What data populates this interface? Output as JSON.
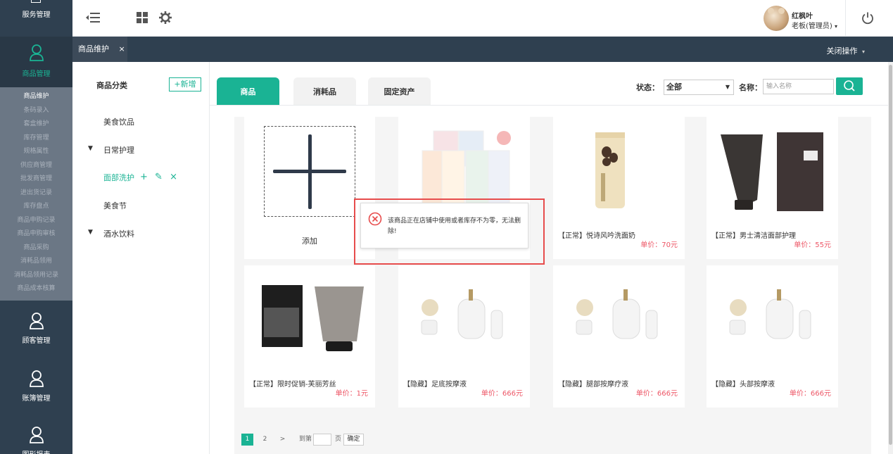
{
  "nav": {
    "top_label": "服务管理",
    "sections": [
      {
        "label": "商品管理",
        "icon": "user-icon"
      },
      {
        "label": "顾客管理",
        "icon": "user-icon"
      },
      {
        "label": "账簿管理",
        "icon": "user-icon"
      },
      {
        "label": "图形报表",
        "icon": "user-icon"
      }
    ],
    "sub_items": [
      "商品维护",
      "条码录入",
      "套盒维护",
      "库存管理",
      "规格属性",
      "供应商管理",
      "批发商管理",
      "进出货记录",
      "库存盘点",
      "商品申购记录",
      "商品申购审核",
      "商品采购",
      "消耗品领用",
      "消耗品领用记录",
      "商品成本核算"
    ]
  },
  "topbar": {
    "icons": [
      "menu-collapse-icon",
      "grid-icon",
      "gear-icon"
    ],
    "user_name": "红枫叶",
    "user_role": "老板(管理员)",
    "caret": "▾"
  },
  "tabstrip": {
    "tab_label": "商品维护",
    "tab_close": "×",
    "close_ops": "关闭操作",
    "caret": "▾"
  },
  "category": {
    "title": "商品分类",
    "add_label": "+新增",
    "arrow": "▼",
    "items": [
      "美食饮品",
      "日常护理",
      "面部洗护",
      "美食节",
      "酒水饮料"
    ]
  },
  "main": {
    "tabs": [
      "商品",
      "消耗品",
      "固定资产"
    ],
    "status_label": "状态：",
    "status_value": "全部",
    "name_label": "名称：",
    "name_placeholder": "输入名称",
    "add_label": "添加",
    "products": [
      {
        "name": "【正常】悦诗风吟洗面奶",
        "price": "单价：70元"
      },
      {
        "name": "【正常】男士清洁面部护理",
        "price": "单价：55元"
      },
      {
        "name": "【正常】限时促销-芙丽芳丝",
        "price": "单价：1元"
      },
      {
        "name": "【隐藏】足底按摩液",
        "price": "单价：666元"
      },
      {
        "name": "【隐藏】腿部按摩疗液",
        "price": "单价：666元"
      },
      {
        "name": "【隐藏】头部按摩液",
        "price": "单价：666元"
      }
    ],
    "alert_text": "该商品正在店铺中使用或者库存不为零，无法删除!"
  },
  "pager": {
    "pages": [
      "1",
      "2",
      ">"
    ],
    "goto_label": "到第",
    "page_label": "页",
    "confirm_label": "确定"
  },
  "colors": {
    "accent": "#1ab394",
    "nav_bg": "#2f4050",
    "price_red": "#ed5565",
    "alert_red": "#e74c4c"
  }
}
